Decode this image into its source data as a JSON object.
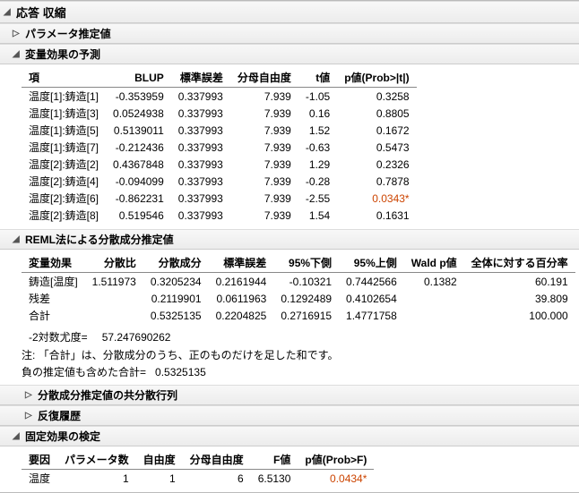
{
  "title": "応答 収縮",
  "sections": {
    "param_est": {
      "title": "パラメータ推定値",
      "open": false
    },
    "random_pred": {
      "title": "変量効果の予測",
      "headers": [
        "項",
        "BLUP",
        "標準誤差",
        "分母自由度",
        "t値",
        "p値(Prob>|t|)"
      ],
      "rows": [
        [
          "温度[1]:鋳造[1]",
          "-0.353959",
          "0.337993",
          "7.939",
          "-1.05",
          "0.3258",
          ""
        ],
        [
          "温度[1]:鋳造[3]",
          "0.0524938",
          "0.337993",
          "7.939",
          "0.16",
          "0.8805",
          ""
        ],
        [
          "温度[1]:鋳造[5]",
          "0.5139011",
          "0.337993",
          "7.939",
          "1.52",
          "0.1672",
          ""
        ],
        [
          "温度[1]:鋳造[7]",
          "-0.212436",
          "0.337993",
          "7.939",
          "-0.63",
          "0.5473",
          ""
        ],
        [
          "温度[2]:鋳造[2]",
          "0.4367848",
          "0.337993",
          "7.939",
          "1.29",
          "0.2326",
          ""
        ],
        [
          "温度[2]:鋳造[4]",
          "-0.094099",
          "0.337993",
          "7.939",
          "-0.28",
          "0.7878",
          ""
        ],
        [
          "温度[2]:鋳造[6]",
          "-0.862231",
          "0.337993",
          "7.939",
          "-2.55",
          "0.0343",
          "*"
        ],
        [
          "温度[2]:鋳造[8]",
          "0.519546",
          "0.337993",
          "7.939",
          "1.54",
          "0.1631",
          ""
        ]
      ]
    },
    "reml": {
      "title": "REML法による分散成分推定値",
      "headers": [
        "変量効果",
        "分散比",
        "分散成分",
        "標準誤差",
        "95%下側",
        "95%上側",
        "Wald p値",
        "全体に対する百分率"
      ],
      "rows": [
        [
          "鋳造[温度]",
          "1.511973",
          "0.3205234",
          "0.2161944",
          "-0.10321",
          "0.7442566",
          "0.1382",
          "60.191"
        ],
        [
          "残差",
          "",
          "0.2119901",
          "0.0611963",
          "0.1292489",
          "0.4102654",
          "",
          "39.809"
        ],
        [
          "合計",
          "",
          "0.5325135",
          "0.2204825",
          "0.2716915",
          "1.4771758",
          "",
          "100.000"
        ]
      ],
      "loglike_label": "-2対数尤度=",
      "loglike_val": "57.247690262",
      "note1": "注: 「合計」は、分散成分のうち、正のものだけを足した和です。",
      "note2_label": "負の推定値も含めた合計=",
      "note2_val": "0.5325135"
    },
    "cov": {
      "title": "分散成分推定値の共分散行列",
      "open": false
    },
    "iter": {
      "title": "反復履歴",
      "open": false
    },
    "fixed": {
      "title": "固定効果の検定",
      "headers": [
        "要因",
        "パラメータ数",
        "自由度",
        "分母自由度",
        "F値",
        "p値(Prob>F)"
      ],
      "rows": [
        [
          "温度",
          "1",
          "1",
          "6",
          "6.5130",
          "0.0434",
          "*"
        ]
      ]
    }
  }
}
